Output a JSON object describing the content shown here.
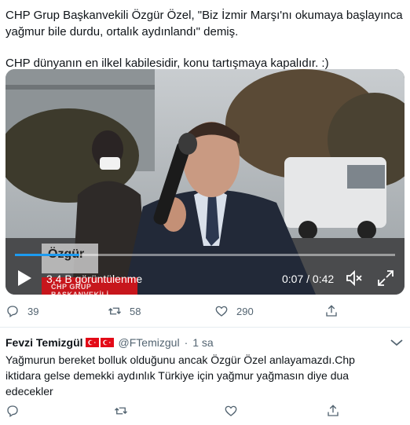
{
  "tweet": {
    "line1": "CHP Grup Başkanvekili Özgür Özel, \"Biz İzmir Marşı'nı okumaya başlayınca",
    "line2": "yağmur bile durdu, ortalık aydınlandı\" demiş.",
    "line3": "CHP dünyanın en ilkel kabilesidir, konu tartışmaya kapalıdır. :)"
  },
  "video": {
    "overlay_name": "Özgür",
    "overlay_name2": "Öz",
    "overlay_bar": "CHP GRUP BAŞKANVEKİLİ",
    "views": "3,4 B görüntülenme",
    "time": "0:07 / 0:42",
    "progress": 0.17
  },
  "tweet_actions": {
    "replies": "39",
    "retweets": "58",
    "likes": "290"
  },
  "reply": {
    "name": "Fevzi Temizgül",
    "handle": "@FTemizgul",
    "separator": "·",
    "time": "1 sa",
    "line1": "Yağmurun bereket bolluk olduğunu ancak Özgür Özel anlayamazdı.Chp",
    "line2": "iktidara gelse demekki aydınlık Türkiye için yağmur yağmasın diye dua",
    "line3": "edecekler"
  },
  "reply_actions": {
    "replies": "",
    "retweets": "",
    "likes": ""
  },
  "colors": {
    "text": "#0f1419",
    "muted": "#536471",
    "accent": "#1d9bf0",
    "flag_red": "#e30a17"
  }
}
